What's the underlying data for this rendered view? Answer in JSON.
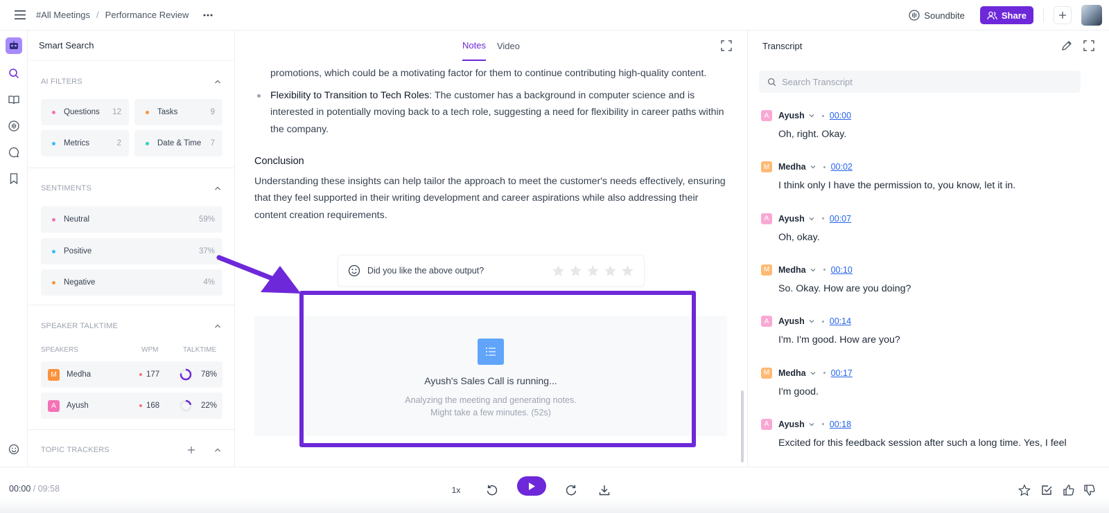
{
  "header": {
    "breadcrumb_root": "#All Meetings",
    "breadcrumb_sep": "/",
    "breadcrumb_page": "Performance Review",
    "soundbite_label": "Soundbite",
    "share_label": "Share"
  },
  "smart_search": {
    "title": "Smart Search",
    "ai_filters": {
      "title": "AI FILTERS",
      "items": [
        {
          "label": "Questions",
          "count": "12",
          "color": "#f472b6"
        },
        {
          "label": "Tasks",
          "count": "9",
          "color": "#fb923c"
        },
        {
          "label": "Metrics",
          "count": "2",
          "color": "#38bdf8"
        },
        {
          "label": "Date & Time",
          "count": "7",
          "color": "#2dd4bf"
        }
      ]
    },
    "sentiments": {
      "title": "SENTIMENTS",
      "items": [
        {
          "label": "Neutral",
          "value": "59%",
          "color": "#f472b6"
        },
        {
          "label": "Positive",
          "value": "37%",
          "color": "#38bdf8"
        },
        {
          "label": "Negative",
          "value": "4%",
          "color": "#fb923c"
        }
      ]
    },
    "speaker_talktime": {
      "title": "SPEAKER TALKTIME",
      "col_speakers": "SPEAKERS",
      "col_wpm": "WPM",
      "col_talktime": "TALKTIME",
      "speakers": [
        {
          "initial": "M",
          "name": "Medha",
          "wpm": "177",
          "talktime": "78%",
          "talktime_fraction": 0.78,
          "color": "#fb923c"
        },
        {
          "initial": "A",
          "name": "Ayush",
          "wpm": "168",
          "talktime": "22%",
          "talktime_fraction": 0.22,
          "color": "#f472b6"
        }
      ]
    },
    "topic_trackers": {
      "title": "TOPIC TRACKERS"
    }
  },
  "notes": {
    "tabs": [
      {
        "label": "Notes",
        "active": true
      },
      {
        "label": "Video",
        "active": false
      }
    ],
    "partial_line": "promotions, which could be a motivating factor for them to continue contributing high-quality content.",
    "bullet_title": "Flexibility to Transition to Tech Roles",
    "bullet_body": ": The customer has a background in computer science and is interested in potentially moving back to a tech role, suggesting a need for flexibility in career paths within the company.",
    "conclusion_title": "Conclusion",
    "conclusion_body": "Understanding these insights can help tailor the approach to meet the customer's needs effectively, ensuring that they feel supported in their writing development and career aspirations while also addressing their content creation requirements.",
    "feedback_question": "Did you like the above output?",
    "rating_max": 5,
    "running_title": "Ayush's Sales Call is running...",
    "running_sub1": "Analyzing the meeting and generating notes.",
    "running_sub2": "Might take a few minutes. (52s)"
  },
  "transcript": {
    "title": "Transcript",
    "search_placeholder": "Search Transcript",
    "entries": [
      {
        "speaker": "Ayush",
        "initial": "A",
        "color": "#f9a8d4",
        "time": "00:00",
        "text": "Oh, right. Okay."
      },
      {
        "speaker": "Medha",
        "initial": "M",
        "color": "#fdba74",
        "time": "00:02",
        "text": "I think only I have the permission to, you know, let it in."
      },
      {
        "speaker": "Ayush",
        "initial": "A",
        "color": "#f9a8d4",
        "time": "00:07",
        "text": "Oh, okay."
      },
      {
        "speaker": "Medha",
        "initial": "M",
        "color": "#fdba74",
        "time": "00:10",
        "text": "So. Okay. How are you doing?"
      },
      {
        "speaker": "Ayush",
        "initial": "A",
        "color": "#f9a8d4",
        "time": "00:14",
        "text": "I'm. I'm good. How are you?"
      },
      {
        "speaker": "Medha",
        "initial": "M",
        "color": "#fdba74",
        "time": "00:17",
        "text": "I'm good."
      },
      {
        "speaker": "Ayush",
        "initial": "A",
        "color": "#f9a8d4",
        "time": "00:18",
        "text": "Excited for this feedback session after such a long time. Yes, I feel"
      }
    ]
  },
  "player": {
    "current_time": "00:00",
    "separator": "/",
    "total_time": "09:58",
    "speed": "1x"
  },
  "colors": {
    "accent": "#6d28d9",
    "link": "#2563eb"
  }
}
